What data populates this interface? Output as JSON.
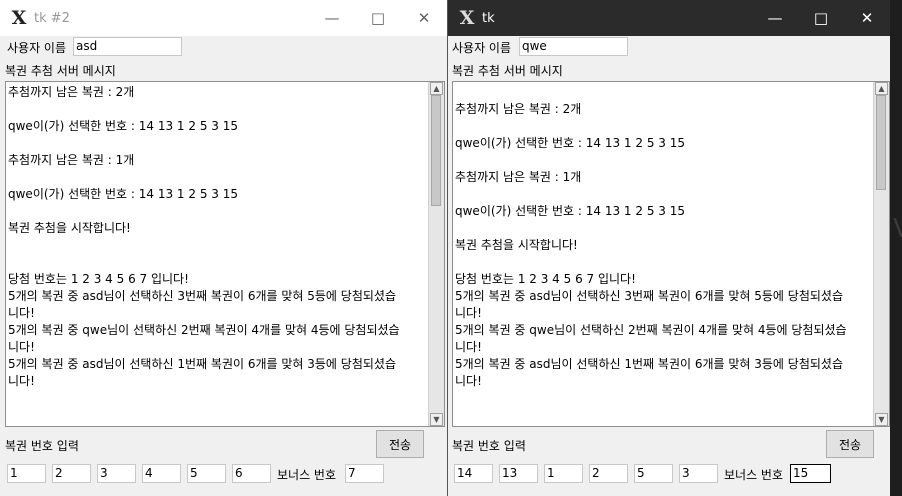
{
  "windows": [
    {
      "title": "tk #2",
      "username_label": "사용자 이름",
      "username_value": "asd",
      "messages_label": "복권 추첨 서버 메시지",
      "messages": [
        "추첨까지 남은 복권 : 2개",
        "",
        "qwe이(가) 선택한 번호 : 14 13 1 2 5 3 15",
        "",
        "추첨까지 남은 복권 : 1개",
        "",
        "qwe이(가) 선택한 번호 : 14 13 1 2 5 3 15",
        "",
        "복권 추첨을 시작합니다!",
        "",
        "",
        "당첨 번호는 1 2 3 4 5 6 7 입니다!",
        "5개의 복권 중 asd님이 선택하신 3번째 복권이 6개를 맞혀 5등에 당첨되셨습",
        "니다!",
        "5개의 복권 중 qwe님이 선택하신 2번째 복권이 4개를 맞혀 4등에 당첨되셨습",
        "니다!",
        "5개의 복권 중 asd님이 선택하신 1번째 복권이 6개를 맞혀 3등에 당첨되셨습",
        "니다!"
      ],
      "scroll_fraction": 0.35,
      "input_label": "복권 번호 입력",
      "send_label": "전송",
      "numbers": [
        "1",
        "2",
        "3",
        "4",
        "5",
        "6"
      ],
      "bonus_label": "보너스 번호",
      "bonus_value": "7"
    },
    {
      "title": "tk",
      "username_label": "사용자 이름",
      "username_value": "qwe",
      "messages_label": "복권 추첨 서버 메시지",
      "messages": [
        "",
        "추첨까지 남은 복권 : 2개",
        "",
        "qwe이(가) 선택한 번호 : 14 13 1 2 5 3 15",
        "",
        "추첨까지 남은 복권 : 1개",
        "",
        "qwe이(가) 선택한 번호 : 14 13 1 2 5 3 15",
        "",
        "복권 추첨을 시작합니다!",
        "",
        "당첨 번호는 1 2 3 4 5 6 7 입니다!",
        "5개의 복권 중 asd님이 선택하신 3번째 복권이 6개를 맞혀 5등에 당첨되셨습",
        "니다!",
        "5개의 복권 중 qwe님이 선택하신 2번째 복권이 4개를 맞혀 4등에 당첨되셨습",
        "니다!",
        "5개의 복권 중 asd님이 선택하신 1번째 복권이 6개를 맞혀 3등에 당첨되셨습",
        "니다!"
      ],
      "scroll_fraction": 0.3,
      "input_label": "복권 번호 입력",
      "send_label": "전송",
      "numbers": [
        "14",
        "13",
        "1",
        "2",
        "5",
        "3"
      ],
      "bonus_label": "보너스 번호",
      "bonus_value": "15"
    }
  ],
  "icons": {
    "app": "tk-feather-icon",
    "minimize": "minimize-icon",
    "maximize": "maximize-icon",
    "close": "close-icon",
    "scroll_up": "scroll-up-arrow-icon",
    "scroll_down": "scroll-down-arrow-icon"
  },
  "colors": {
    "active_titlebar": "#2b2b2b",
    "inactive_titlebar": "#ffffff",
    "window_bg": "#f0f0f0"
  }
}
